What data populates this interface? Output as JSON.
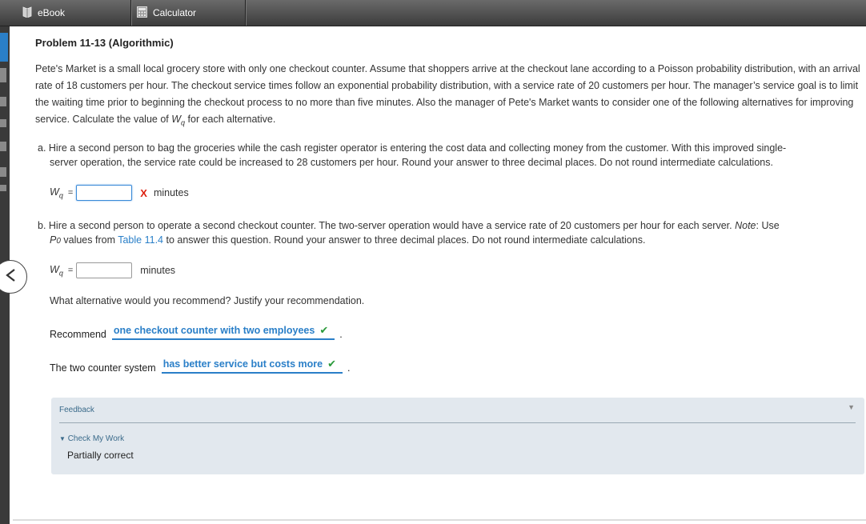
{
  "toolbar": {
    "ebook_label": "eBook",
    "calculator_label": "Calculator"
  },
  "problem": {
    "title": "Problem 11-13 (Algorithmic)",
    "intro": "Pete's Market is a small local grocery store with only one checkout counter. Assume that shoppers arrive at the checkout lane according to a Poisson probability distribution, with an arrival rate of 18 customers per hour. The checkout service times follow an exponential probability distribution, with a service rate of 20 customers per hour. The manager’s service goal is to limit the waiting time prior to beginning the checkout process to no more than five minutes. Also the manager of Pete's Market wants to consider one of the following alternatives for improving service. Calculate the value of ",
    "intro_wq": "W",
    "intro_wq_sub": "q",
    "intro_end": " for each alternative."
  },
  "part_a": {
    "text_line1": "a. Hire a second person to bag the groceries while the cash register operator is entering the cost data and collecting money from the customer. With this improved single-",
    "text_line2": "server operation, the service rate could be increased to 28 customers per hour. Round your answer to three decimal places. Do not round intermediate calculations.",
    "var": "W",
    "var_sub": "q",
    "equals": "=",
    "value": "",
    "mark": "X",
    "unit": "minutes"
  },
  "part_b": {
    "text_line1": "b. Hire a second person to operate a second checkout counter. The two-server operation would have a service rate of 20 customers per hour for each server. ",
    "note_label": "Note",
    "text_line1_end": ": Use",
    "p0": "P",
    "p0_sub": "0",
    "text_line2_a": " values from ",
    "table_link": "Table 11.4",
    "text_line2_b": " to answer this question. Round your answer to three decimal places. Do not round intermediate calculations.",
    "var": "W",
    "var_sub": "q",
    "equals": "=",
    "value": "",
    "unit": "minutes"
  },
  "recommendation": {
    "question": "What alternative would you recommend? Justify your recommendation.",
    "recommend_label": "Recommend",
    "recommend_value": "one checkout counter with two employees",
    "recommend_period": ".",
    "two_counter_label": "The two counter system",
    "two_counter_value": "has better service but costs more",
    "two_counter_period": "."
  },
  "feedback": {
    "title": "Feedback",
    "check_label": "Check My Work",
    "result": "Partially correct"
  }
}
